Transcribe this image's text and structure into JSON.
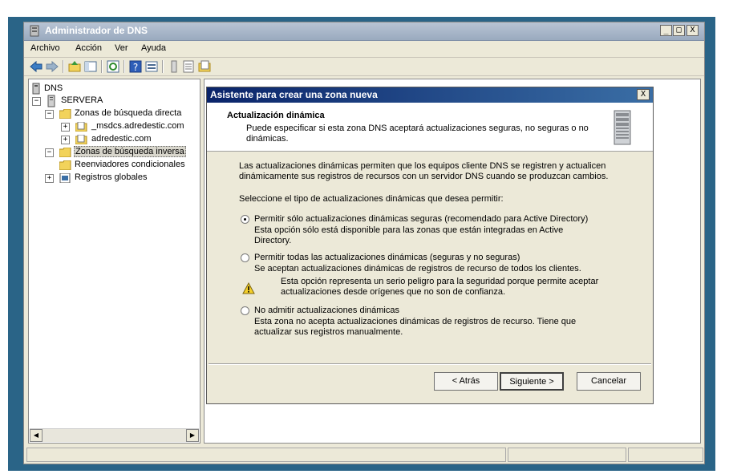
{
  "window": {
    "title": "Administrador de DNS",
    "controls": [
      "_",
      "□",
      "X"
    ]
  },
  "menu": [
    "Archivo",
    "Acción",
    "Ver",
    "Ayuda"
  ],
  "toolbar_icons": [
    "back-icon",
    "forward-icon",
    "up-folder-icon",
    "show-hide-tree-icon",
    "refresh-icon",
    "help-icon",
    "properties-icon",
    "server-icon",
    "list-icon",
    "zone-icon"
  ],
  "tree": {
    "root": "DNS",
    "server": "SERVERA",
    "forward_zones": "Zonas de búsqueda directa",
    "zone1": "_msdcs.adredestic.com",
    "zone2": "adredestic.com",
    "reverse_zones": "Zonas de búsqueda inversa",
    "conditional": "Reenviadores condicionales",
    "global": "Registros globales"
  },
  "dialog": {
    "title": "Asistente para crear una zona nueva",
    "close": "X",
    "header_title": "Actualización dinámica",
    "header_sub": "Puede especificar si esta zona DNS aceptará actualizaciones seguras, no seguras o no dinámicas.",
    "intro": "Las actualizaciones dinámicas permiten que los equipos cliente DNS se registren y actualicen dinámicamente sus registros de recursos con un servidor DNS cuando se produzcan cambios.",
    "prompt": "Seleccione el tipo de actualizaciones dinámicas que desea permitir:",
    "options": [
      {
        "label": "Permitir sólo actualizaciones dinámicas seguras (recomendado para Active Directory)",
        "desc": "Esta opción sólo está disponible para las zonas que están integradas en Active Directory.",
        "selected": true
      },
      {
        "label": "Permitir todas las actualizaciones dinámicas (seguras y no seguras)",
        "desc": "Se aceptan actualizaciones dinámicas de registros de recurso de todos los clientes.",
        "warning": "Esta opción representa un serio peligro para la seguridad porque permite aceptar actualizaciones desde orígenes que no son de confianza.",
        "selected": false
      },
      {
        "label": "No admitir actualizaciones dinámicas",
        "desc": "Esta zona no acepta actualizaciones dinámicas de registros de recurso. Tiene que actualizar sus registros manualmente.",
        "selected": false
      }
    ],
    "buttons": {
      "back": "< Atrás",
      "next": "Siguiente >",
      "cancel": "Cancelar"
    }
  }
}
